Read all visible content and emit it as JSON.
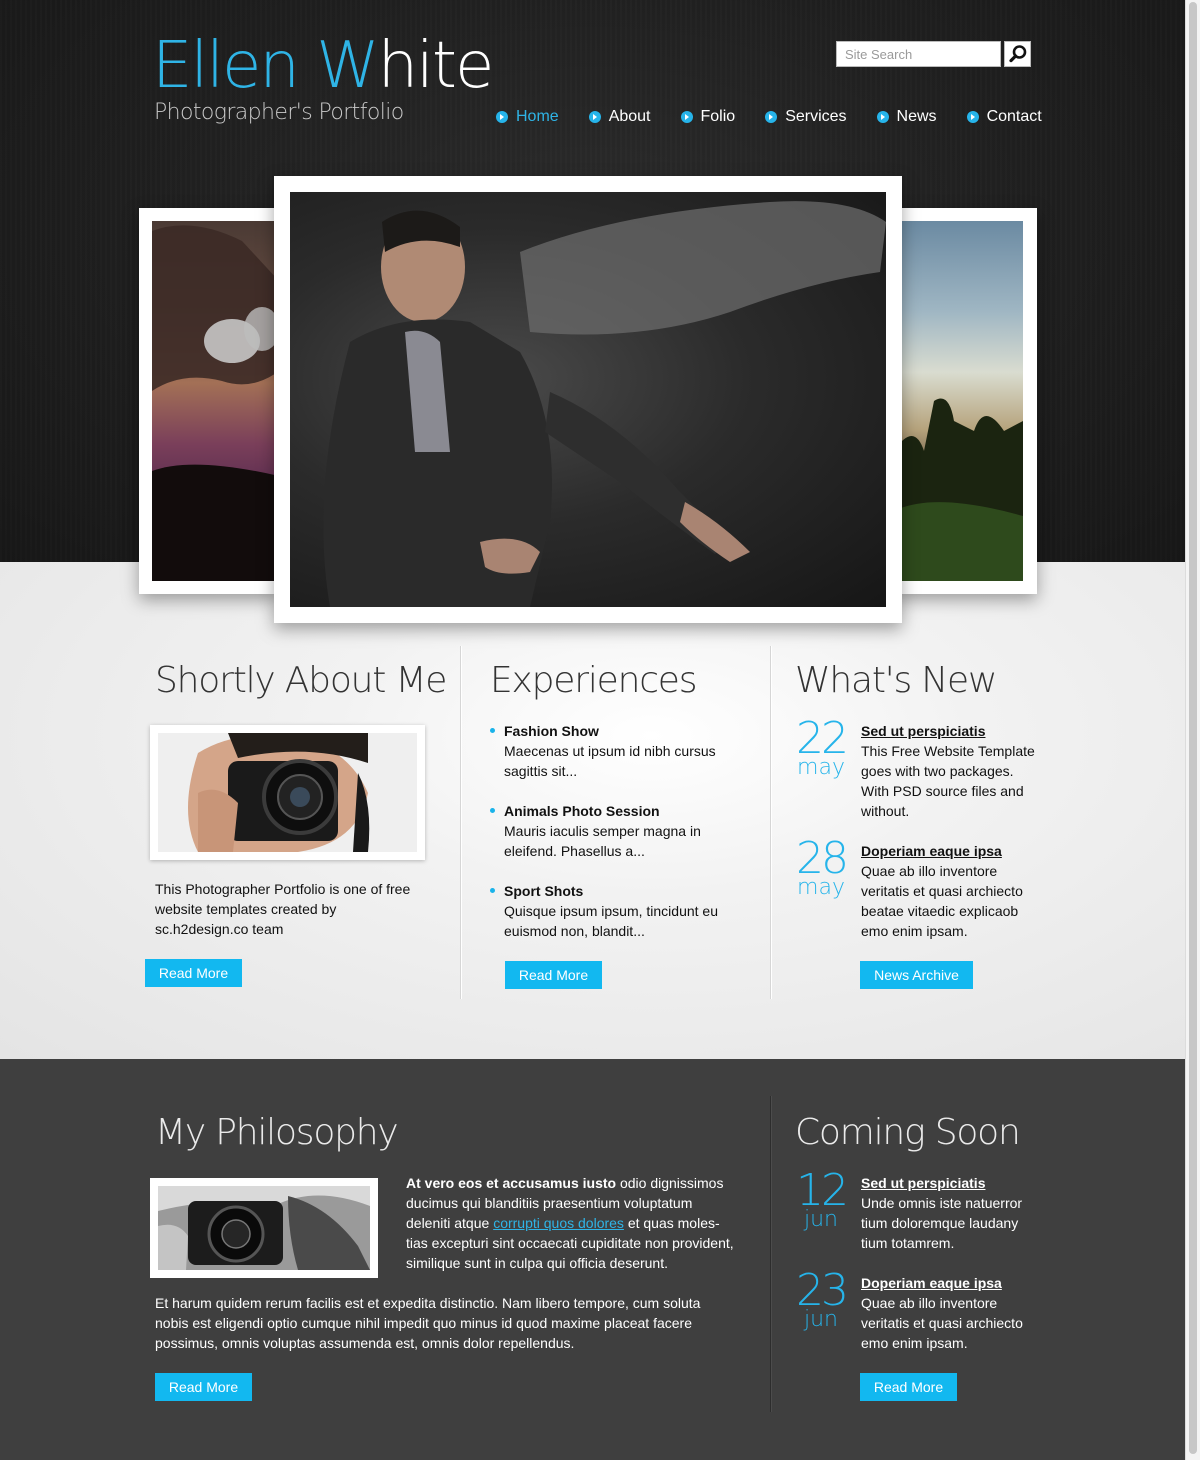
{
  "header": {
    "logo_first": "Ellen",
    "logo_last_w": "W",
    "logo_last_rest": "hite",
    "tagline": "Photographer's Portfolio",
    "search_placeholder": "Site Search"
  },
  "nav": {
    "items": [
      "Home",
      "About",
      "Folio",
      "Services",
      "News",
      "Contact"
    ],
    "active": "Home"
  },
  "about": {
    "title": "Shortly About Me",
    "text": "This Photographer Portfolio is one of free website templates created by sc.h2design.co team",
    "button": "Read More"
  },
  "experiences": {
    "title": "Experiences",
    "items": [
      {
        "title": "Fashion Show",
        "text": "Maecenas ut ipsum id nibh cursus sagittis sit..."
      },
      {
        "title": "Animals Photo Session",
        "text": "Mauris iaculis semper magna in eleifend. Phasellus a..."
      },
      {
        "title": "Sport Shots",
        "text": "Quisque ipsum ipsum, tincidunt eu euismod non, blandit..."
      }
    ],
    "button": "Read More"
  },
  "whats_new": {
    "title": "What's New",
    "items": [
      {
        "day": "22",
        "month": "may",
        "title": "Sed ut perspiciatis",
        "text": "This Free Website Template goes with two packages. With PSD source files and without."
      },
      {
        "day": "28",
        "month": "may",
        "title": "Doperiam eaque ipsa",
        "text": "Quae ab illo inventore veritatis et quasi archiecto beatae vitaedic explicaob emo enim ipsam."
      }
    ],
    "button": "News Archive"
  },
  "philosophy": {
    "title": "My Philosophy",
    "lead_bold": "At vero eos et accusamus iusto",
    "lead_rest_1": " odio dignissimos ducimus qui blanditiis praesentium voluptatum deleniti atque ",
    "link": "corrupti quos dolores",
    "lead_rest_2": " et quas moles-tias excepturi sint occaecati cupiditate non provident, similique sunt in culpa qui officia deserunt.",
    "para2": "Et harum quidem rerum facilis est et expedita distinctio. Nam libero tempore, cum soluta nobis est eligendi optio cumque nihil impedit quo minus id quod maxime placeat facere possimus, omnis voluptas assumenda est, omnis dolor repellendus.",
    "button": "Read More"
  },
  "coming_soon": {
    "title": "Coming Soon",
    "items": [
      {
        "day": "12",
        "month": "jun",
        "title": "Sed ut perspiciatis",
        "text": "Unde omnis iste natuerror tium doloremque laudany tium totamrem."
      },
      {
        "day": "23",
        "month": "jun",
        "title": "Doperiam eaque ipsa",
        "text": "Quae ab illo inventore veritatis et quasi archiecto emo enim ipsam."
      }
    ],
    "button": "Read More"
  },
  "colors": {
    "accent": "#2fb4e6",
    "button": "#12b8f0",
    "header_bg": "#1f1f1f",
    "dark_band": "#3f3f3f"
  },
  "icons": [
    "search-icon",
    "nav-arrow-icon",
    "bullet-icon"
  ]
}
